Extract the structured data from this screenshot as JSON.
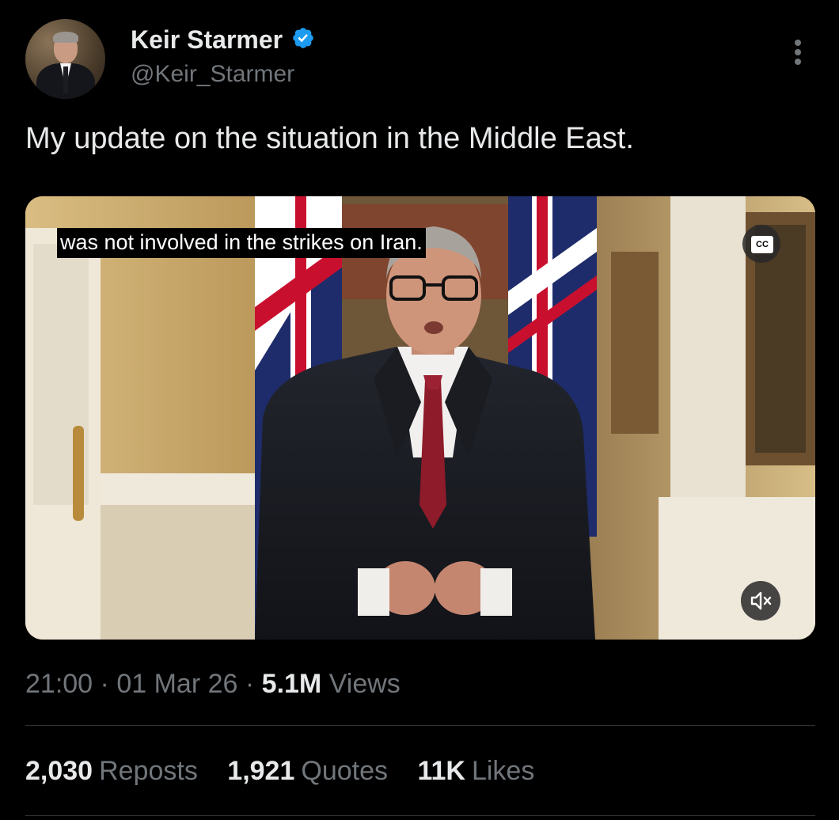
{
  "author": {
    "display_name": "Keir Starmer",
    "handle": "@Keir_Starmer",
    "verified": true,
    "verified_color": "#1d9bf0",
    "avatar_icon": "profile-photo"
  },
  "menu": {
    "icon": "more-vertical-icon"
  },
  "tweet": {
    "text": "My update on the situation in the Middle East."
  },
  "video": {
    "subtitle": "was not involved in the strikes on Iran.",
    "cc_label": "CC",
    "mute_icon": "speaker-muted-icon"
  },
  "meta": {
    "time": "21:00",
    "separator": "·",
    "date": "01 Mar 26",
    "views_count": "5.1M",
    "views_label": "Views"
  },
  "stats": {
    "reposts_count": "2,030",
    "reposts_label": "Reposts",
    "quotes_count": "1,921",
    "quotes_label": "Quotes",
    "likes_count": "11K",
    "likes_label": "Likes"
  },
  "colors": {
    "background": "#000000",
    "primary_text": "#e7e9ea",
    "secondary_text": "#71767b",
    "divider": "#2f3336"
  }
}
